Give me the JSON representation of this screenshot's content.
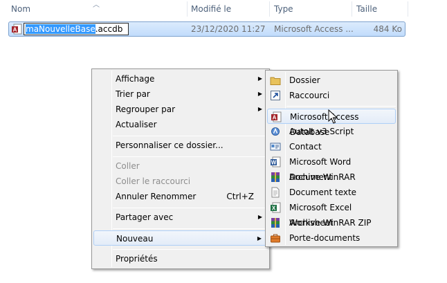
{
  "columns": {
    "name": "Nom",
    "modified": "Modifié le",
    "type": "Type",
    "size": "Taille"
  },
  "file": {
    "rename_selected": "maNouvelleBase",
    "rename_ext": ".accdb",
    "modified": "23/12/2020 11:27",
    "type": "Microsoft Access ...",
    "size": "484 Ko"
  },
  "context_menu": {
    "view": "Affichage",
    "sort_by": "Trier par",
    "group_by": "Regrouper par",
    "refresh": "Actualiser",
    "customize": "Personnaliser ce dossier...",
    "paste": "Coller",
    "paste_shortcut": "Coller le raccourci",
    "undo_rename": "Annuler Renommer",
    "undo_shortcut": "Ctrl+Z",
    "share_with": "Partager avec",
    "new": "Nouveau",
    "properties": "Propriétés"
  },
  "new_submenu": {
    "folder": "Dossier",
    "shortcut": "Raccourci",
    "access_db": "Microsoft Access Database",
    "autoit": "AutoIt v3 Script",
    "contact": "Contact",
    "word": "Microsoft Word Document",
    "winrar": "Archive WinRAR",
    "text": "Document texte",
    "excel": "Microsoft Excel Worksheet",
    "winrar_zip": "Archive WinRAR ZIP",
    "briefcase": "Porte-documents"
  },
  "colors": {
    "selection": "#3399ff",
    "header_text": "#4c607a",
    "menu_bg": "#f0f0f0",
    "highlight_border": "#aecff7"
  }
}
